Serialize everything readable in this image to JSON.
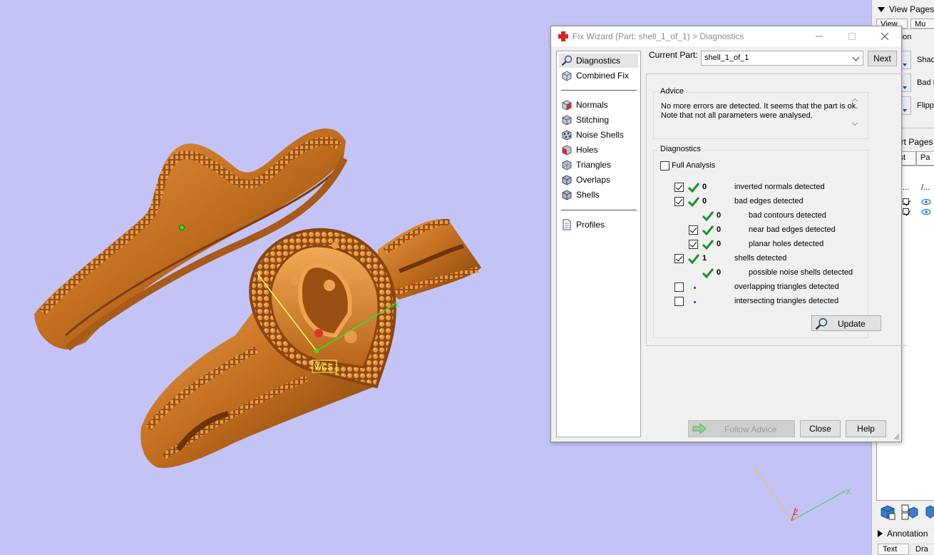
{
  "dialog": {
    "title": "Fix Wizard (Part: shell_1_of_1) > Diagnostics",
    "current_part_label": "Current Part:",
    "current_part_value": "shell_1_of_1",
    "next_label": "Next",
    "nav": {
      "diagnostics": "Diagnostics",
      "combined_fix": "Combined Fix",
      "normals": "Normals",
      "stitching": "Stitching",
      "noise_shells": "Noise Shells",
      "holes": "Holes",
      "triangles": "Triangles",
      "overlaps": "Overlaps",
      "shells": "Shells",
      "profiles": "Profiles"
    },
    "advice": {
      "title": "Advice",
      "text": "No more errors are detected. It seems that the part is ok. Note that not all parameters were analysed."
    },
    "diagnostics": {
      "title": "Diagnostics",
      "full_analysis": "Full Analysis",
      "rows": [
        {
          "count": "0",
          "label": "inverted normals detected"
        },
        {
          "count": "0",
          "label": "bad edges detected"
        },
        {
          "count": "0",
          "label": "bad contours detected"
        },
        {
          "count": "0",
          "label": "near bad edges detected"
        },
        {
          "count": "0",
          "label": "planar holes detected"
        },
        {
          "count": "1",
          "label": "shells detected"
        },
        {
          "count": "0",
          "label": "possible noise shells detected"
        },
        {
          "count": "",
          "label": "overlapping triangles detected"
        },
        {
          "count": "",
          "label": "intersecting triangles detected"
        }
      ],
      "update_label": "Update"
    },
    "buttons": {
      "follow_advice": "Follow Advice",
      "close": "Close",
      "help": "Help"
    }
  },
  "right_panel": {
    "view_pages": "View Pages",
    "tab_view": "View",
    "tab_mu": "Mu",
    "visualization": "alization",
    "shad": "Shad",
    "bad_e": "Bad E",
    "flippe": "Flippe",
    "part_pages": "art Pages",
    "tab_list": "ist",
    "tab_pa": "Pa",
    "col_dots": "...",
    "col_slash": "/...",
    "annotation": "Annotation",
    "tab_text": "Text",
    "tab_dra": "Dra"
  },
  "viewport": {
    "wcs_label": "WCS",
    "axis_x": "X",
    "axis_y": "Y",
    "axis_z": "Z",
    "background": "#c3c3f6",
    "model_color": "#c8701c"
  }
}
